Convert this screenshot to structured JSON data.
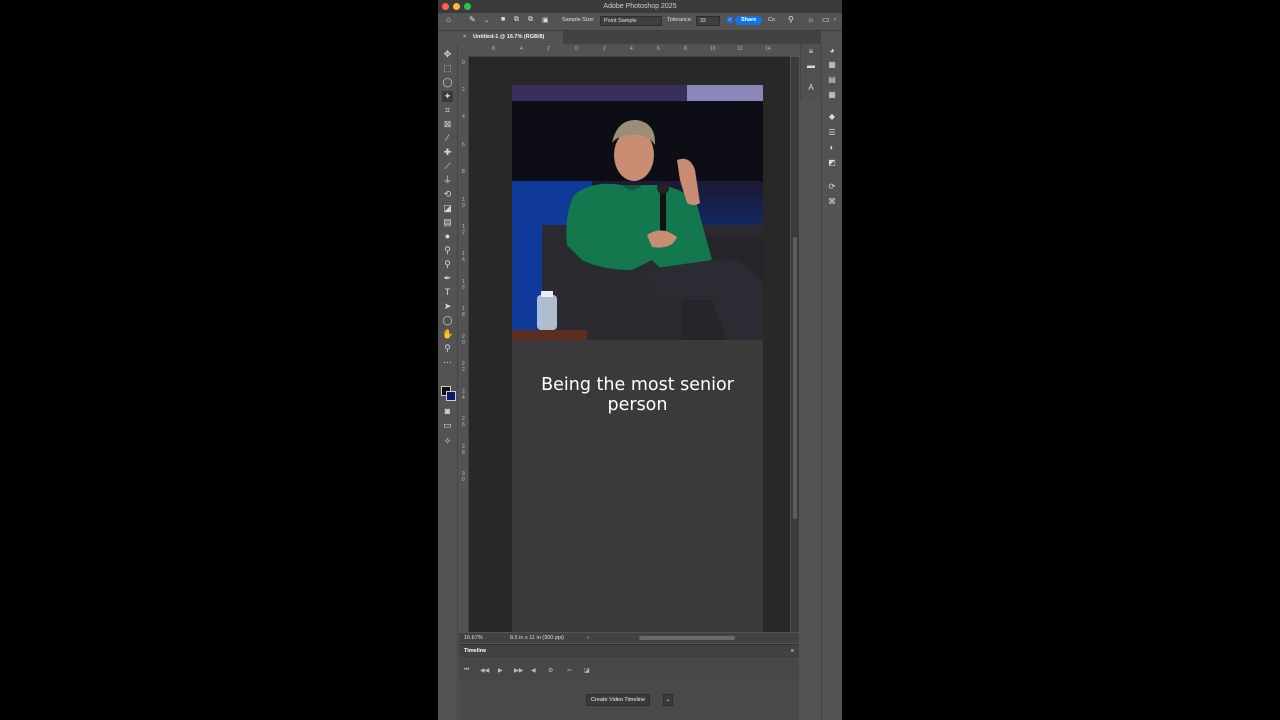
{
  "window": {
    "title": "Adobe Photoshop 2025"
  },
  "options_bar": {
    "sample_size_label": "Sample Size:",
    "sample_size_value": "Point Sample",
    "tolerance_label": "Tolerance:",
    "tolerance_value": "32",
    "share_label": "Share",
    "extra_label": "Co"
  },
  "document": {
    "tab_title": "Untitled-1 @ 16.7% (RGB/8)",
    "caption": "Being the most senior person"
  },
  "ruler_top": [
    "8",
    "4",
    "2",
    "0",
    "2",
    "4",
    "6",
    "8",
    "10",
    "12",
    "14"
  ],
  "ruler_left": [
    "0",
    "2",
    "4",
    "6",
    "8",
    "1 0",
    "1 2",
    "1 4",
    "1 6",
    "1 8",
    "2 0",
    "2 2",
    "2 4",
    "2 6",
    "2 8",
    "3 0"
  ],
  "status_bar": {
    "zoom": "16.67%",
    "doc_info": "8.5 in x 11 in (300 ppi)",
    "arrow": "›"
  },
  "timeline": {
    "title": "Timeline",
    "create_button": "Create Video Timeline",
    "menu": "≡"
  },
  "colors": {
    "share": "#1473e6",
    "panel": "#535353",
    "canvas": "#282828",
    "artboard": "#3a3a3a"
  }
}
